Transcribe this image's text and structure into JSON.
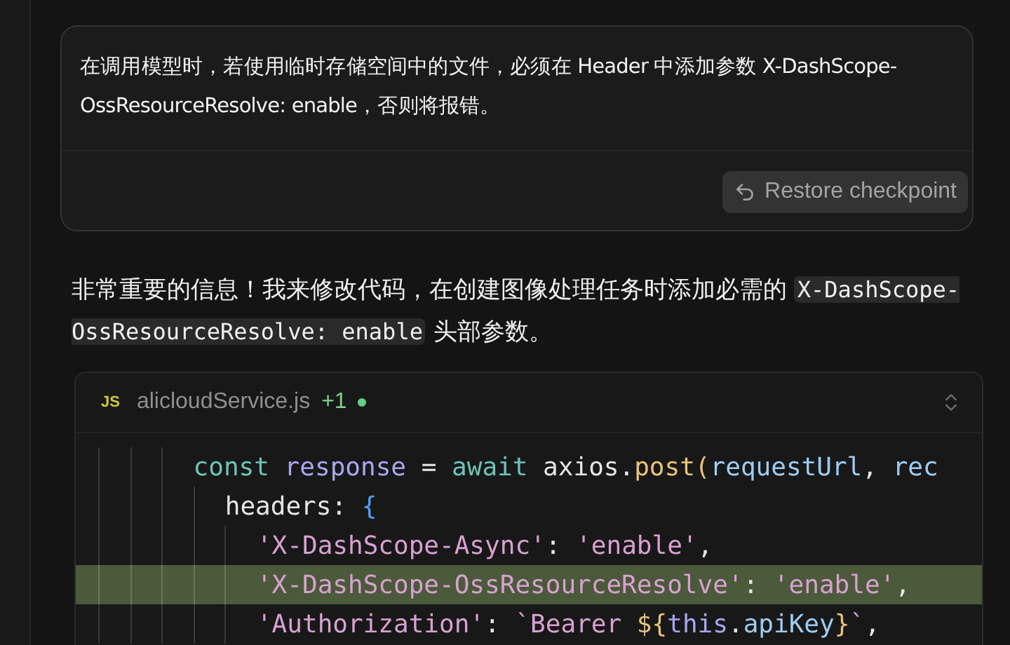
{
  "user_message": {
    "text": "在调用模型时，若使用临时存储空间中的文件，必须在 Header 中添加参数 X-DashScope-OssResourceResolve: enable，否则将报错。",
    "restore_button": "Restore checkpoint"
  },
  "reply": {
    "parts": [
      {
        "kind": "text",
        "text": "非常重要的信息！我来修改代码，在创建图像处理任务时添加必需的 "
      },
      {
        "kind": "code",
        "text": "X-DashScope-OssResourceResolve: enable"
      },
      {
        "kind": "text",
        "text": " 头部参数。"
      }
    ]
  },
  "code_block": {
    "language_badge": "JS",
    "file_name": "alicloudService.js",
    "change_count": "+1",
    "modified": true,
    "lines": [
      {
        "highlight": false,
        "tokens": [
          {
            "kind": "keyword",
            "text": "const"
          },
          {
            "kind": "variable",
            "text": " response"
          },
          {
            "kind": "plain",
            "text": " = "
          },
          {
            "kind": "keyword",
            "text": "await"
          },
          {
            "kind": "plain",
            "text": " axios."
          },
          {
            "kind": "function",
            "text": "post("
          },
          {
            "kind": "param",
            "text": "requestUrl"
          },
          {
            "kind": "plain",
            "text": ", "
          },
          {
            "kind": "param",
            "text": "rec"
          }
        ],
        "children": [
          {
            "highlight": false,
            "tokens": [
              {
                "kind": "plain",
                "text": "headers: "
              },
              {
                "kind": "brace",
                "text": "{"
              }
            ],
            "children": [
              {
                "highlight": false,
                "tokens": [
                  {
                    "kind": "string",
                    "text": "'X-DashScope-Async'"
                  },
                  {
                    "kind": "plain",
                    "text": ": "
                  },
                  {
                    "kind": "string",
                    "text": "'enable'"
                  },
                  {
                    "kind": "plain",
                    "text": ","
                  }
                ]
              },
              {
                "highlight": true,
                "tokens": [
                  {
                    "kind": "string",
                    "text": "'X-DashScope-OssResourceResolve'"
                  },
                  {
                    "kind": "plain",
                    "text": ": "
                  },
                  {
                    "kind": "string",
                    "text": "'enable'"
                  },
                  {
                    "kind": "plain",
                    "text": ","
                  }
                ]
              },
              {
                "highlight": false,
                "tokens": [
                  {
                    "kind": "string",
                    "text": "'Authorization'"
                  },
                  {
                    "kind": "plain",
                    "text": ": "
                  },
                  {
                    "kind": "string",
                    "text": "`Bearer "
                  },
                  {
                    "kind": "function",
                    "text": "${"
                  },
                  {
                    "kind": "variable",
                    "text": "this"
                  },
                  {
                    "kind": "plain",
                    "text": "."
                  },
                  {
                    "kind": "param",
                    "text": "apiKey"
                  },
                  {
                    "kind": "function",
                    "text": "}"
                  },
                  {
                    "kind": "string",
                    "text": "`"
                  },
                  {
                    "kind": "plain",
                    "text": ","
                  }
                ]
              }
            ]
          }
        ]
      }
    ]
  }
}
